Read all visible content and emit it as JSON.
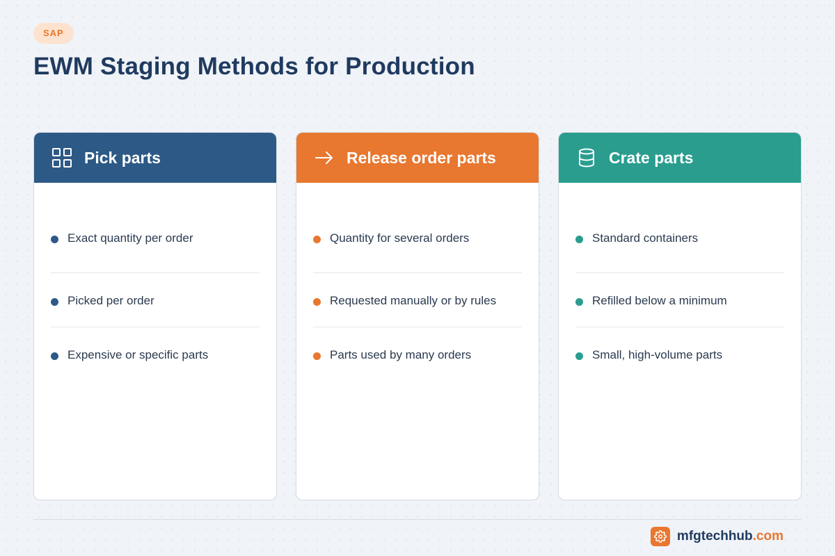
{
  "header": {
    "tag": "SAP",
    "title": "EWM Staging Methods for Production"
  },
  "cards": [
    {
      "title": "Pick parts",
      "icon": "grid-icon",
      "color": "#2d5986",
      "items": [
        "Exact quantity per order",
        "Picked per order",
        "Expensive or specific parts"
      ]
    },
    {
      "title": "Release order parts",
      "icon": "arrow-right-icon",
      "color": "#e8772f",
      "items": [
        "Quantity for several orders",
        "Requested manually or by rules",
        "Parts used by many orders"
      ]
    },
    {
      "title": "Crate parts",
      "icon": "database-icon",
      "color": "#2a9d8f",
      "items": [
        "Standard containers",
        "Refilled below a minimum",
        "Small, high-volume parts"
      ]
    }
  ],
  "footer": {
    "brand_name": "mfgtechhub",
    "brand_tld": ".com",
    "brand_icon": "gear-icon",
    "accent": "#e8772f"
  }
}
